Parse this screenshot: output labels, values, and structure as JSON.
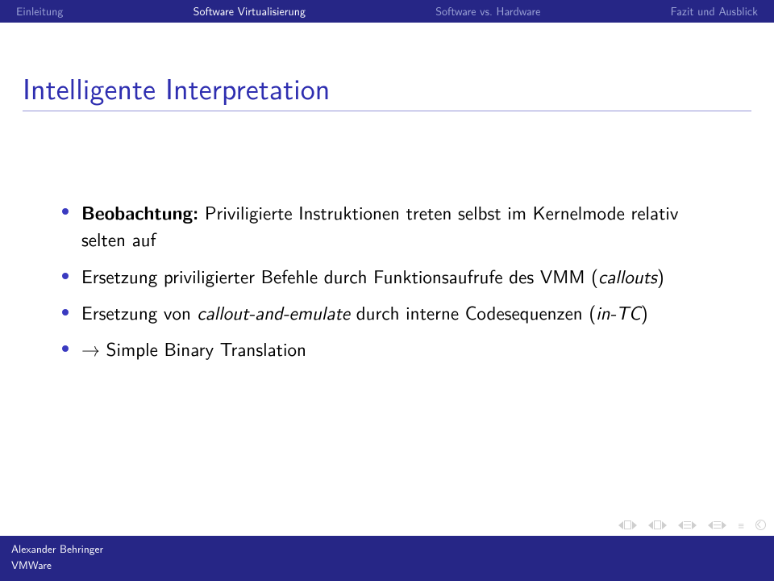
{
  "nav": {
    "items": [
      {
        "label": "Einleitung",
        "active": false
      },
      {
        "label": "Software Virtualisierung",
        "active": true
      },
      {
        "label": "Software vs. Hardware",
        "active": false
      },
      {
        "label": "Fazit und Ausblick",
        "active": false
      }
    ]
  },
  "title": "Intelligente Interpretation",
  "bullets": [
    {
      "prefix": "Beobachtung:",
      "text_before": " Priviligierte Instruktionen treten selbst im Kernelmode relativ selten auf"
    },
    {
      "line2_a": "Ersetzung priviligierter Befehle durch Funktionsaufrufe des VMM (",
      "line2_it": "callouts",
      "line2_b": ")"
    },
    {
      "line3_a": "Ersetzung von ",
      "line3_it1": "callout-and-emulate",
      "line3_b": " durch interne Codesequenzen (",
      "line3_it2": "in-TC",
      "line3_c": ")"
    },
    {
      "arrow": "→",
      "line4": " Simple Binary Translation"
    }
  ],
  "footer": {
    "author": "Alexander Behringer",
    "subject": "VMWare"
  }
}
